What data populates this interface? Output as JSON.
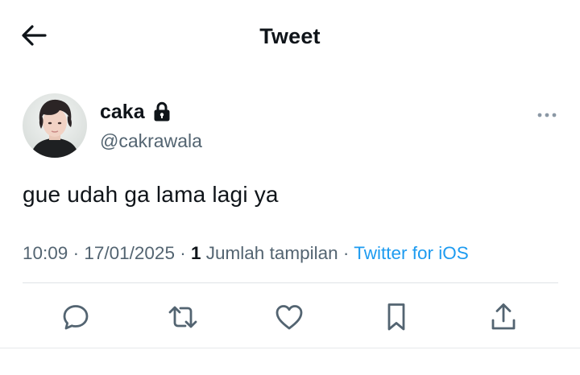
{
  "header": {
    "title": "Tweet",
    "back_icon": "arrow-left-icon"
  },
  "author": {
    "display_name": "caka",
    "handle": "@cakrawala",
    "protected_icon": "lock-icon",
    "more_icon": "more-horizontal-icon"
  },
  "tweet": {
    "text": "gue udah ga lama lagi ya",
    "time": "10:09",
    "date": "17/01/2025",
    "views_count": "1",
    "views_label": "Jumlah tampilan",
    "source": "Twitter for iOS",
    "separator": "·"
  },
  "actions": {
    "reply_icon": "reply-icon",
    "retweet_icon": "retweet-icon",
    "like_icon": "heart-icon",
    "bookmark_icon": "bookmark-icon",
    "share_icon": "share-icon"
  },
  "colors": {
    "text_primary": "#0f1419",
    "text_secondary": "#536471",
    "link": "#1d9bf0",
    "divider": "#dfe3e6"
  }
}
